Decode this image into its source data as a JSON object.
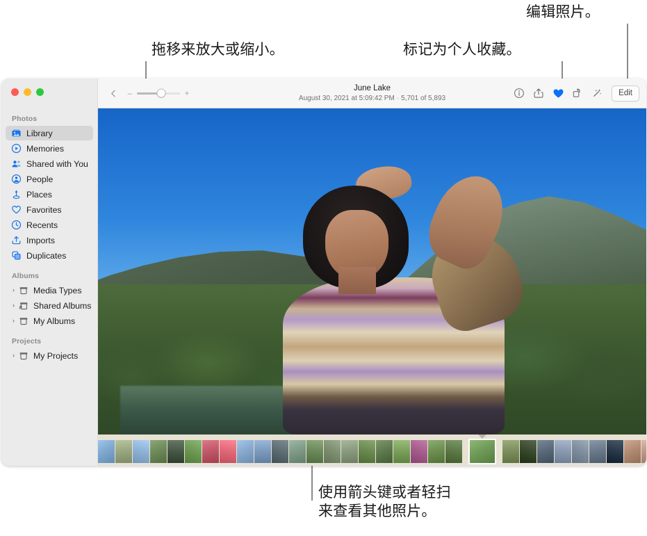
{
  "app": {
    "name": "Photos",
    "window_controls": [
      "close",
      "minimize",
      "zoom"
    ]
  },
  "callouts": [
    {
      "id": "zoom-slider-callout",
      "text": "拖移来放大或缩小。",
      "points_to": "zoom-slider"
    },
    {
      "id": "favorite-callout",
      "text": "标记为个人收藏。",
      "points_to": "favorite-button"
    },
    {
      "id": "edit-callout",
      "text": "编辑照片。",
      "points_to": "edit-button"
    },
    {
      "id": "filmstrip-callout",
      "text": "使用箭头键或者轻扫\n来查看其他照片。",
      "points_to": "filmstrip"
    }
  ],
  "sidebar": {
    "groups": [
      {
        "title": "Photos",
        "items": [
          {
            "label": "Library",
            "icon": "library-icon",
            "selected": true,
            "disclosure": false
          },
          {
            "label": "Memories",
            "icon": "memories-icon",
            "selected": false,
            "disclosure": false
          },
          {
            "label": "Shared with You",
            "icon": "shared-with-you-icon",
            "selected": false,
            "disclosure": false
          },
          {
            "label": "People",
            "icon": "people-icon",
            "selected": false,
            "disclosure": false
          },
          {
            "label": "Places",
            "icon": "places-icon",
            "selected": false,
            "disclosure": false
          },
          {
            "label": "Favorites",
            "icon": "heart-icon",
            "selected": false,
            "disclosure": false
          },
          {
            "label": "Recents",
            "icon": "clock-icon",
            "selected": false,
            "disclosure": false
          },
          {
            "label": "Imports",
            "icon": "import-icon",
            "selected": false,
            "disclosure": false
          },
          {
            "label": "Duplicates",
            "icon": "duplicates-icon",
            "selected": false,
            "disclosure": false
          }
        ]
      },
      {
        "title": "Albums",
        "items": [
          {
            "label": "Media Types",
            "icon": "album-icon",
            "selected": false,
            "disclosure": true
          },
          {
            "label": "Shared Albums",
            "icon": "shared-album-icon",
            "selected": false,
            "disclosure": true
          },
          {
            "label": "My Albums",
            "icon": "album-icon",
            "selected": false,
            "disclosure": true
          }
        ]
      },
      {
        "title": "Projects",
        "items": [
          {
            "label": "My Projects",
            "icon": "album-icon",
            "selected": false,
            "disclosure": true
          }
        ]
      }
    ]
  },
  "toolbar": {
    "back_label": "‹",
    "zoom_out_label": "–",
    "zoom_in_label": "+",
    "zoom_value_percent": 57,
    "title": "June Lake",
    "subtitle_date": "August 30, 2021 at 5:09:42 PM",
    "subtitle_separator": "·",
    "subtitle_count": "5,701 of 5,893",
    "buttons": [
      {
        "label": "Info",
        "icon": "info-icon",
        "active": false
      },
      {
        "label": "Share",
        "icon": "share-icon",
        "active": false
      },
      {
        "label": "Favorite",
        "icon": "heart-filled-icon",
        "active": true
      },
      {
        "label": "Rotate",
        "icon": "rotate-icon",
        "active": false
      },
      {
        "label": "Enhance",
        "icon": "magic-wand-icon",
        "active": false
      }
    ],
    "edit_label": "Edit"
  },
  "photo": {
    "title": "June Lake",
    "alt": "Person shielding eyes from sun in front of mountain lake",
    "accent_favorite_color": "#0a72f5"
  },
  "filmstrip": {
    "selected_index": 21,
    "thumbs": [
      "#7fa8cf",
      "#9aa882",
      "#8fb3d6",
      "#6f8a5a",
      "#4a5a48",
      "#6f9a55",
      "#c05a6a",
      "#e06a7a",
      "#86a9cd",
      "#7d9bbd",
      "#5f6e72",
      "#7f9a86",
      "#6d8a5c",
      "#7e8f72",
      "#8a9a7e",
      "#6b8a52",
      "#5f7a4e",
      "#7aa05c",
      "#a65f8c",
      "#6d8f52",
      "#5d7a48",
      "#6f9a58",
      "#7d8f5e",
      "#3a4a2e",
      "#5a6a7a",
      "#8a9ab0",
      "#7f8f9f",
      "#6a7a8a",
      "#2a3a4a",
      "#b08a72",
      "#c09a8a",
      "#8a7a6a",
      "#9a8a7a",
      "#6a5a4a",
      "#7a6a5a",
      "#5a4a3a",
      "#8a8a8a",
      "#6a6a6a",
      "#7a7a7a",
      "#5a5a5a"
    ]
  }
}
